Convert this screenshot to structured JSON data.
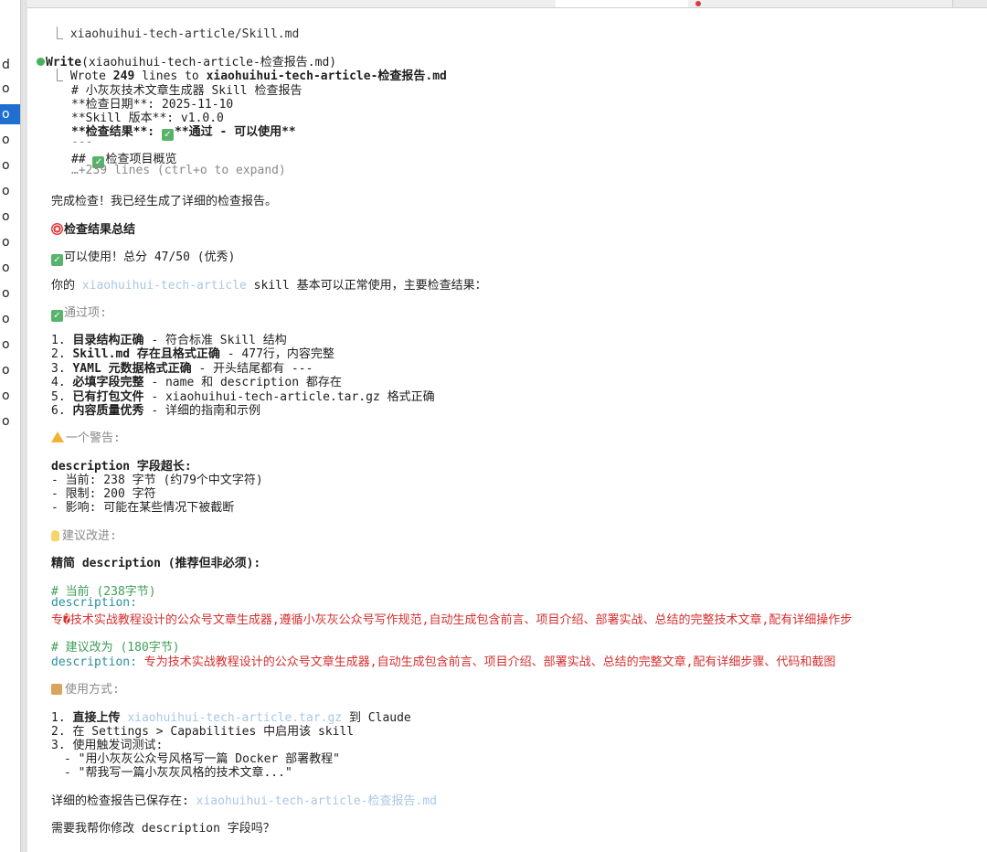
{
  "left_panel": {
    "items": [
      "d",
      "o",
      "o",
      "o",
      "o",
      "o",
      "o",
      "o",
      "o",
      "o",
      "o",
      "o",
      "o",
      "o",
      "o"
    ],
    "selected_index": 2
  },
  "prev_line": "⎿  xiaohuihui-tech-article/Skill.md",
  "write": {
    "verb": "Write",
    "args": "(xiaohuihui-tech-article-检查报告.md)",
    "wrote_prefix": "⎿  Wrote ",
    "count": "249",
    "lines_to": " lines to ",
    "file": "xiaohuihui-tech-article-检查报告.md",
    "preview": [
      "# 小灰灰技术文章生成器 Skill 检查报告",
      "**检查日期**: 2025-11-10",
      "**Skill 版本**: v1.0.0"
    ],
    "result_line_prefix": "**检查结果**: ",
    "result_line_rest": "**通过 - 可以使用**",
    "sep": "---",
    "heading_prefix": "## ",
    "heading_rest": "检查项目概览",
    "more": "…+239 lines (ctrl+o to expand)"
  },
  "summary": {
    "done": "完成检查！我已经生成了详细的检查报告。",
    "title": "检查结果总结",
    "score": "可以使用！总分 47/50 (优秀)",
    "intro_pre": "你的 ",
    "intro_link": "xiaohuihui-tech-article",
    "intro_post": " skill 基本可以正常使用，主要检查结果：",
    "passed_label": "通过项:",
    "passed": [
      {
        "num": "1.",
        "bold": "目录结构正确",
        "rest": " - 符合标准 Skill 结构"
      },
      {
        "num": "2.",
        "bold": "Skill.md 存在且格式正确",
        "rest": " - 477行，内容完整"
      },
      {
        "num": "3.",
        "bold": "YAML 元数据格式正确",
        "rest": " - 开头结尾都有 ---"
      },
      {
        "num": "4.",
        "bold": "必填字段完整",
        "rest": " - name 和 description 都存在"
      },
      {
        "num": "5.",
        "bold": "已有打包文件",
        "rest": " - xiaohuihui-tech-article.tar.gz 格式正确"
      },
      {
        "num": "6.",
        "bold": "内容质量优秀",
        "rest": " - 详细的指南和示例"
      }
    ],
    "warning_label": "一个警告:",
    "warn_title": "description 字段超长:",
    "warn_items": [
      "- 当前: 238 字节 (约79个中文字符)",
      "- 限制: 200 字符",
      "- 影响: 可能在某些情况下被截断"
    ],
    "suggest_label": "建议改进:",
    "suggest_title": "精简 description (推荐但非必须):",
    "code_current_comment": "# 当前 (238字节)",
    "code_key": "description:",
    "code_current_value": "专�技术实战教程设计的公众号文章生成器,遵循小灰灰公众号写作规范,自动生成包含前言、项目介绍、部署实战、总结的完整技术文章,配有详细操作步",
    "code_suggest_comment": "# 建议改为 (180字节)",
    "code_suggest_value": "专为技术实战教程设计的公众号文章生成器,自动生成包含前言、项目介绍、部署实战、总结的完整文章,配有详细步骤、代码和截图",
    "usage_label": "使用方式:",
    "usage_1_num": "1.",
    "usage_1_bold": "直接上传",
    "usage_1_link": "xiaohuihui-tech-article.tar.gz",
    "usage_1_rest": " 到 Claude",
    "usage_2": "2. 在 Settings > Capabilities 中启用该 skill",
    "usage_3": "3. 使用触发词测试:",
    "usage_3a": "- \"用小灰灰公众号风格写一篇 Docker 部署教程\"",
    "usage_3b": "- \"帮我写一篇小灰灰风格的技术文章...\"",
    "saved_pre": "详细的检查报告已保存在: ",
    "saved_link": "xiaohuihui-tech-article-检查报告.md",
    "question": "需要我帮你修改 description 字段吗？"
  },
  "colors": {
    "accent_blue": "#1f6fd1",
    "check_green": "#57b46a",
    "code_red": "#d62f2f",
    "code_teal": "#2a8f9e"
  }
}
